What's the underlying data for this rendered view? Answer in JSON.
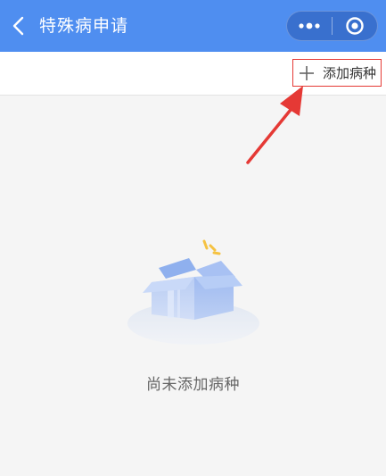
{
  "header": {
    "title": "特殊病申请",
    "background_color": "#4f8ef0",
    "back_icon": "chevron-left-icon",
    "more_icon": "more-dots-icon",
    "close_icon": "target-circle-icon"
  },
  "toolbar": {
    "add_label": "添加病种",
    "add_icon": "plus-icon",
    "highlight_color": "#e53935"
  },
  "empty_state": {
    "message": "尚未添加病种",
    "illustration": "open-box-icon"
  },
  "annotation": {
    "arrow_color": "#e53935"
  }
}
